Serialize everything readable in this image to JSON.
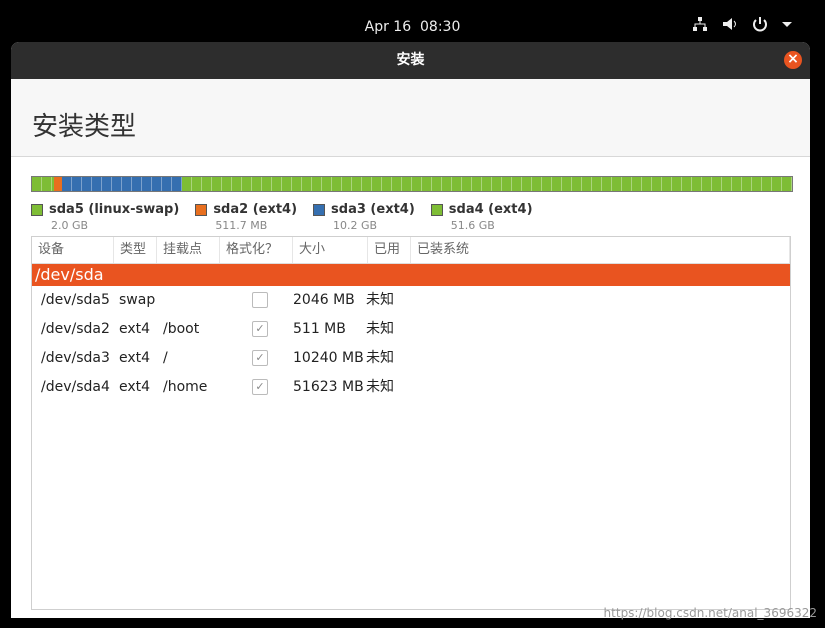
{
  "topbar": {
    "date": "Apr 16",
    "time": "08:30"
  },
  "window": {
    "title": "安装"
  },
  "page_title": "安装类型",
  "partitions": [
    {
      "name": "sda5 (linux-swap)",
      "size": "2.0 GB",
      "color": "#7ebd35"
    },
    {
      "name": "sda2 (ext4)",
      "size": "511.7 MB",
      "color": "#e86f1f"
    },
    {
      "name": "sda3 (ext4)",
      "size": "10.2 GB",
      "color": "#356fb0"
    },
    {
      "name": "sda4 (ext4)",
      "size": "51.6 GB",
      "color": "#7ebd35"
    }
  ],
  "table": {
    "headers": [
      "设备",
      "类型",
      "挂载点",
      "格式化？",
      "大小",
      "已用",
      "已装系统"
    ],
    "device": "/dev/sda",
    "rows": [
      {
        "device": "/dev/sda5",
        "type": "swap",
        "mount": "",
        "format": false,
        "size": "2046 MB",
        "used": "未知"
      },
      {
        "device": "/dev/sda2",
        "type": "ext4",
        "mount": "/boot",
        "format": true,
        "size": "511 MB",
        "used": "未知"
      },
      {
        "device": "/dev/sda3",
        "type": "ext4",
        "mount": "/",
        "format": true,
        "size": "10240 MB",
        "used": "未知"
      },
      {
        "device": "/dev/sda4",
        "type": "ext4",
        "mount": "/home",
        "format": true,
        "size": "51623 MB",
        "used": "未知"
      }
    ]
  },
  "watermark": "https://blog.csdn.net/anal_3696322"
}
